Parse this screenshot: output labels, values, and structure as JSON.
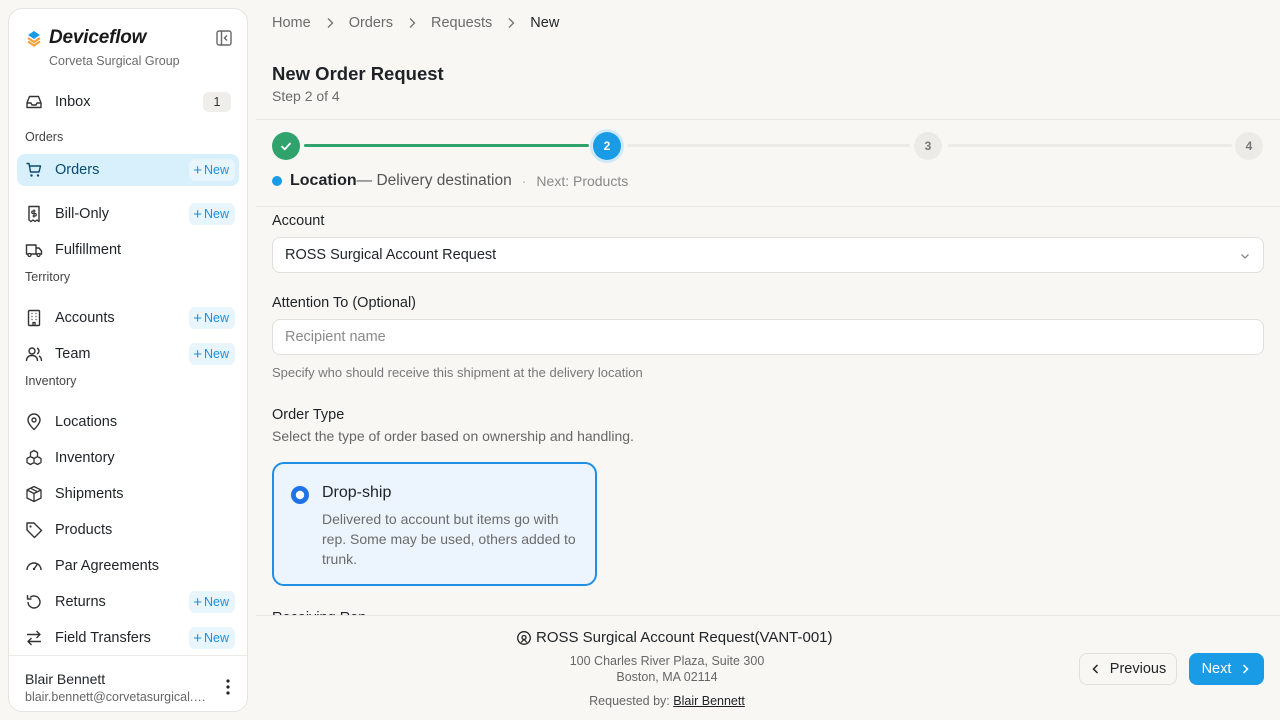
{
  "sidebar": {
    "brand": "Deviceflow",
    "org": "Corveta Surgical Group",
    "inbox": {
      "label": "Inbox",
      "badge": "1"
    },
    "sections": {
      "orders": "Orders",
      "territory": "Territory",
      "inventory": "Inventory"
    },
    "items": {
      "orders": "Orders",
      "bill_only": "Bill-Only",
      "fulfillment": "Fulfillment",
      "accounts": "Accounts",
      "team": "Team",
      "locations": "Locations",
      "inventory": "Inventory",
      "shipments": "Shipments",
      "products": "Products",
      "par_agreements": "Par Agreements",
      "returns": "Returns",
      "field_transfers": "Field Transfers"
    },
    "new_label": "New",
    "user": {
      "name": "Blair Bennett",
      "email": "blair.bennett@corvetasurgical.com"
    }
  },
  "breadcrumb": [
    "Home",
    "Orders",
    "Requests",
    "New"
  ],
  "page": {
    "title": "New Order Request",
    "subtitle": "Step 2 of 4"
  },
  "stepper": {
    "steps": [
      "1",
      "2",
      "3",
      "4"
    ],
    "current_title": "Location",
    "current_desc": "— Delivery destination",
    "separator": "·",
    "next": "Next: Products"
  },
  "form": {
    "account_label": "Account",
    "account_value": "ROSS Surgical Account Request",
    "attention_label": "Attention To (Optional)",
    "attention_placeholder": "Recipient name",
    "attention_help": "Specify who should receive this shipment at the delivery location",
    "order_type_label": "Order Type",
    "order_type_sub": "Select the type of order based on ownership and handling.",
    "option_title": "Drop-ship",
    "option_desc": "Delivered to account but items go with rep. Some may be used, others added to trunk.",
    "next_section_label": "Receiving Rep"
  },
  "footer": {
    "account": "ROSS Surgical Account Request(VANT-001)",
    "address1": "100 Charles River Plaza, Suite 300",
    "address2": "Boston, MA 02114",
    "requested_by_label": "Requested by:",
    "requested_by": "Blair Bennett",
    "prev": "Previous",
    "next": "Next"
  },
  "colors": {
    "accent": "#1a9be6",
    "success": "#2fa36b",
    "active_nav": "#d7f0fb"
  }
}
